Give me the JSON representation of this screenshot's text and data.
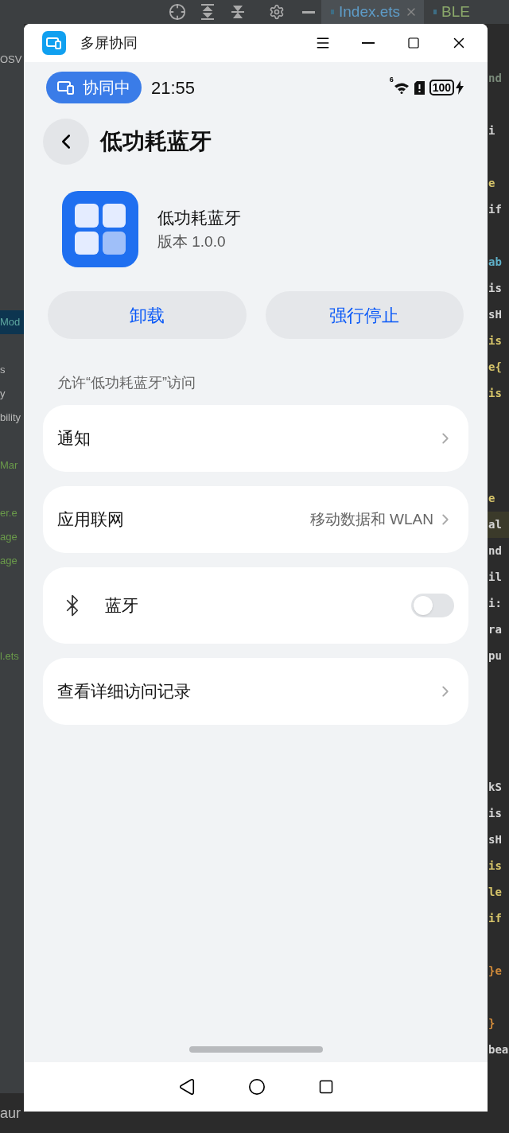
{
  "ide": {
    "tabs": [
      {
        "label": "Index.ets",
        "selected": true
      },
      {
        "label": "BLE",
        "selected": false
      }
    ],
    "tree": [
      {
        "kind": "text",
        "text": "OSV",
        "color": "#bbbbbb",
        "selected": false
      },
      {
        "kind": "blank"
      },
      {
        "kind": "blank"
      },
      {
        "kind": "blank"
      },
      {
        "kind": "blank"
      },
      {
        "kind": "blank"
      },
      {
        "kind": "blank"
      },
      {
        "kind": "blank"
      },
      {
        "kind": "blank"
      },
      {
        "kind": "blank"
      },
      {
        "kind": "blank"
      },
      {
        "kind": "text",
        "text": "Mod",
        "color": "#5fa8a0",
        "selected": true
      },
      {
        "kind": "blank"
      },
      {
        "kind": "text",
        "text": "s",
        "color": "#bbbbbb",
        "selected": false
      },
      {
        "kind": "text",
        "text": "y",
        "color": "#bbbbbb",
        "selected": false
      },
      {
        "kind": "text",
        "text": "bility",
        "color": "#bbbbbb",
        "selected": false
      },
      {
        "kind": "blank"
      },
      {
        "kind": "text",
        "text": "Mar",
        "color": "#6a9a4a",
        "selected": false
      },
      {
        "kind": "blank"
      },
      {
        "kind": "text",
        "text": "er.e",
        "color": "#6a9a4a",
        "selected": false
      },
      {
        "kind": "text",
        "text": "age",
        "color": "#6a9a4a",
        "selected": false
      },
      {
        "kind": "text",
        "text": "age",
        "color": "#6a9a4a",
        "selected": false
      },
      {
        "kind": "blank"
      },
      {
        "kind": "blank"
      },
      {
        "kind": "blank"
      },
      {
        "kind": "text",
        "text": "l.ets",
        "color": "#6a9a4a",
        "selected": false
      }
    ],
    "code": [
      {
        "kind": "text",
        "text": "nd",
        "color": "#7a8a7a"
      },
      {
        "kind": "blank"
      },
      {
        "kind": "text",
        "text": "i",
        "color": "#d4d4d4"
      },
      {
        "kind": "blank"
      },
      {
        "kind": "text",
        "text": "e",
        "color": "#d6c46a"
      },
      {
        "kind": "text",
        "text": "if",
        "color": "#d4d4d4"
      },
      {
        "kind": "blank"
      },
      {
        "kind": "text",
        "text": "ab",
        "color": "#5fb0c8"
      },
      {
        "kind": "text",
        "text": "is",
        "color": "#d4d4d4"
      },
      {
        "kind": "text",
        "text": "sH",
        "color": "#d4d4d4"
      },
      {
        "kind": "text",
        "text": "is",
        "color": "#d6c46a"
      },
      {
        "kind": "text",
        "text": "e{",
        "color": "#d6c46a"
      },
      {
        "kind": "text",
        "text": "is",
        "color": "#d6c46a"
      },
      {
        "kind": "blank"
      },
      {
        "kind": "blank"
      },
      {
        "kind": "blank"
      },
      {
        "kind": "text",
        "text": "e",
        "color": "#d6c46a"
      },
      {
        "kind": "text",
        "text": "al",
        "color": "#d4d4d4",
        "highlighted": true
      },
      {
        "kind": "text",
        "text": "nd",
        "color": "#d4d4d4"
      },
      {
        "kind": "text",
        "text": "il",
        "color": "#d4d4d4"
      },
      {
        "kind": "text",
        "text": "i:",
        "color": "#d4d4d4"
      },
      {
        "kind": "text",
        "text": "ra",
        "color": "#d4d4d4"
      },
      {
        "kind": "text",
        "text": "pu",
        "color": "#d4d4d4"
      },
      {
        "kind": "blank"
      },
      {
        "kind": "blank"
      },
      {
        "kind": "blank"
      },
      {
        "kind": "blank"
      },
      {
        "kind": "text",
        "text": "kS",
        "color": "#d4d4d4"
      },
      {
        "kind": "text",
        "text": "is",
        "color": "#d4d4d4"
      },
      {
        "kind": "text",
        "text": "sH",
        "color": "#d4d4d4"
      },
      {
        "kind": "text",
        "text": "is",
        "color": "#d6c46a"
      },
      {
        "kind": "text",
        "text": "le",
        "color": "#d6c46a"
      },
      {
        "kind": "text",
        "text": "if",
        "color": "#d6c46a"
      },
      {
        "kind": "blank"
      },
      {
        "kind": "text",
        "text": "}e",
        "color": "#d08a3a"
      },
      {
        "kind": "blank"
      },
      {
        "kind": "text",
        "text": "}",
        "color": "#d08a3a"
      },
      {
        "kind": "text",
        "text": "bea",
        "color": "#d4d4d4"
      }
    ],
    "bottom_text": "aur"
  },
  "window": {
    "title": "多屏协同"
  },
  "status_bar": {
    "collab_label": "协同中",
    "time": "21:55",
    "network_badge": "6",
    "battery": "100"
  },
  "page": {
    "title": "低功耗蓝牙"
  },
  "app": {
    "name": "低功耗蓝牙",
    "version": "版本 1.0.0"
  },
  "actions": [
    "卸载",
    "强行停止"
  ],
  "section_label": "允许“低功耗蓝牙”访问",
  "settings": [
    {
      "kind": "link",
      "label": "通知"
    },
    {
      "kind": "link",
      "label": "应用联网",
      "value": "移动数据和 WLAN"
    },
    {
      "kind": "toggle",
      "label": "蓝牙",
      "on": false
    },
    {
      "kind": "link",
      "label": "查看详细访问记录"
    }
  ]
}
